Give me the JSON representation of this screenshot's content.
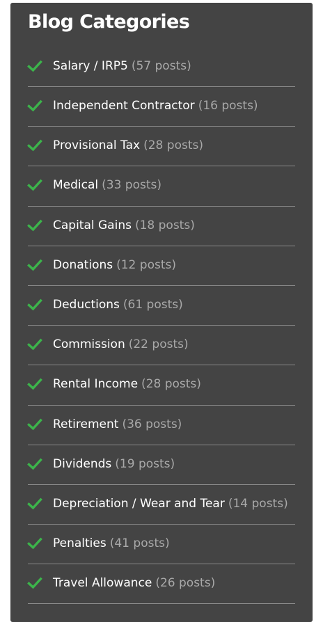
{
  "widget": {
    "title": "Blog Categories",
    "check_color": "#3cb44b",
    "items": [
      {
        "label": "Salary / IRP5",
        "count": "(57 posts)"
      },
      {
        "label": "Independent Contractor",
        "count": "(16 posts)"
      },
      {
        "label": "Provisional Tax",
        "count": "(28 posts)"
      },
      {
        "label": "Medical",
        "count": "(33 posts)"
      },
      {
        "label": "Capital Gains",
        "count": "(18 posts)"
      },
      {
        "label": "Donations",
        "count": "(12 posts)"
      },
      {
        "label": "Deductions",
        "count": "(61 posts)"
      },
      {
        "label": "Commission",
        "count": "(22 posts)"
      },
      {
        "label": "Rental Income",
        "count": "(28 posts)"
      },
      {
        "label": "Retirement",
        "count": "(36 posts)"
      },
      {
        "label": "Dividends",
        "count": "(19 posts)"
      },
      {
        "label": "Depreciation / Wear and Tear",
        "count": "(14 posts)"
      },
      {
        "label": "Penalties",
        "count": "(41 posts)"
      },
      {
        "label": "Travel Allowance",
        "count": "(26 posts)"
      }
    ],
    "icon": "checkmark-icon"
  }
}
